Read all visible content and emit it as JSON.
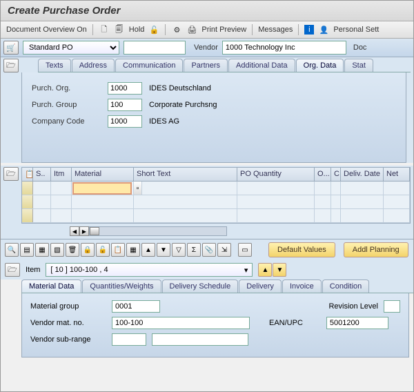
{
  "title": "Create Purchase Order",
  "toolbar": {
    "doc_overview": "Document Overview On",
    "hold": "Hold",
    "print_preview": "Print Preview",
    "messages": "Messages",
    "personal": "Personal Sett"
  },
  "header": {
    "po_type": "Standard PO",
    "po_number": "",
    "vendor_label": "Vendor",
    "vendor_value": "1000 Technology Inc",
    "doc_label": "Doc"
  },
  "header_tabs": [
    "Texts",
    "Address",
    "Communication",
    "Partners",
    "Additional Data",
    "Org. Data",
    "Stat"
  ],
  "org": {
    "purch_org_label": "Purch. Org.",
    "purch_org": "1000",
    "purch_org_text": "IDES Deutschland",
    "purch_group_label": "Purch. Group",
    "purch_group": "100",
    "purch_group_text": "Corporate Purchsng",
    "company_label": "Company Code",
    "company": "1000",
    "company_text": "IDES AG"
  },
  "grid_cols": [
    "S..",
    "Itm",
    "Material",
    "Short Text",
    "PO Quantity",
    "O...",
    "C",
    "Deliv. Date",
    "Net"
  ],
  "buttons": {
    "default_values": "Default Values",
    "addl_planning": "Addl Planning"
  },
  "item": {
    "label": "Item",
    "value": "[ 10 ] 100-100 , 4"
  },
  "detail_tabs": [
    "Material Data",
    "Quantities/Weights",
    "Delivery Schedule",
    "Delivery",
    "Invoice",
    "Condition"
  ],
  "material": {
    "group_label": "Material group",
    "group": "0001",
    "rev_label": "Revision Level",
    "rev": "",
    "vmat_label": "Vendor mat. no.",
    "vmat": "100-100",
    "ean_label": "EAN/UPC",
    "ean": "5001200",
    "vsub_label": "Vendor sub-range",
    "vsub": ""
  }
}
